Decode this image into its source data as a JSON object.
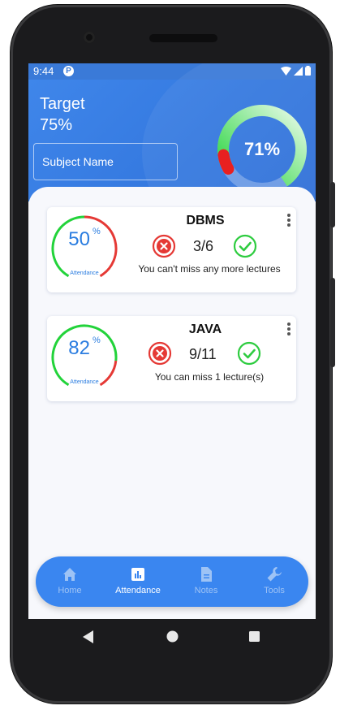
{
  "status_bar": {
    "time": "9:44",
    "notification": "P"
  },
  "header": {
    "target_label": "Target",
    "target_value": "75%",
    "subject_placeholder": "Subject Name",
    "overall_percent_text": "71%",
    "overall_fraction": 0.71
  },
  "subjects": [
    {
      "name": "DBMS",
      "percent": "50",
      "percent_unit": "%",
      "attendance_label": "Attendance",
      "count": "3/6",
      "message": "You can't miss any more lectures",
      "fraction": 0.5
    },
    {
      "name": "JAVA",
      "percent": "82",
      "percent_unit": "%",
      "attendance_label": "Attendance",
      "count": "9/11",
      "message": "You can miss 1 lecture(s)",
      "fraction": 0.82
    }
  ],
  "bottom_nav": [
    {
      "label": "Home",
      "icon": "home-icon",
      "active": false
    },
    {
      "label": "Attendance",
      "icon": "bar-chart-icon",
      "active": true
    },
    {
      "label": "Notes",
      "icon": "note-icon",
      "active": false
    },
    {
      "label": "Tools",
      "icon": "wrench-icon",
      "active": false
    }
  ],
  "colors": {
    "primary": "#3478df",
    "nav": "#3a86f0",
    "present": "#22c55e",
    "absent": "#e53935"
  }
}
